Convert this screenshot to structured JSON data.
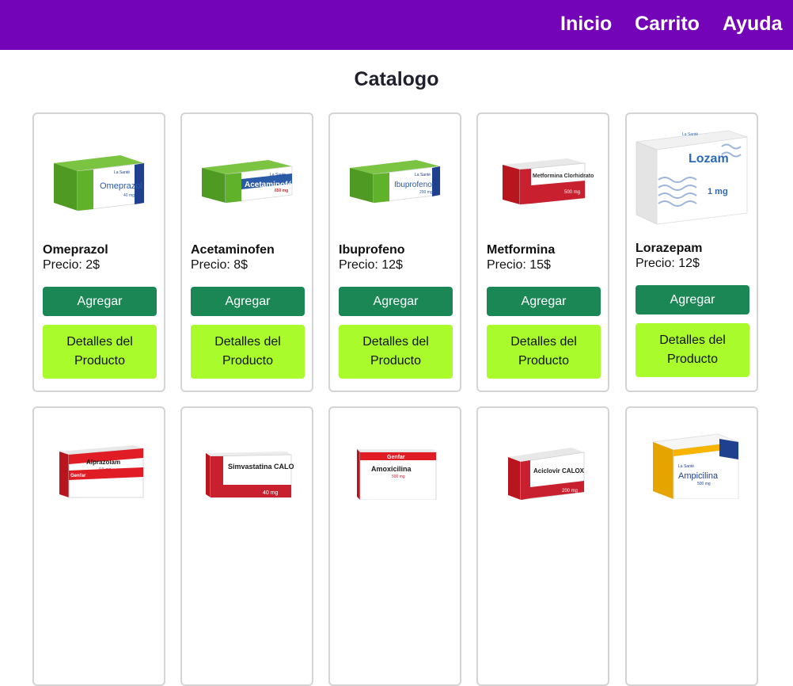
{
  "nav": {
    "links": [
      {
        "label": "Inicio"
      },
      {
        "label": "Carrito"
      },
      {
        "label": "Ayuda"
      }
    ]
  },
  "catalog": {
    "title": "Catalogo",
    "add_label": "Agregar",
    "details_label": "Detalles del Producto",
    "products": [
      {
        "name": "Omeprazol",
        "price": "Precio: 2$",
        "box": {
          "brand": "La Santé",
          "title": "Omeprazol",
          "dose": "40 mg",
          "color": "#5fb22a",
          "face": "#ffffff"
        }
      },
      {
        "name": "Acetaminofen",
        "price": "Precio: 8$",
        "box": {
          "brand": "La Santé",
          "title": "Acetaminofén",
          "dose": "650 mg",
          "color": "#5fb22a",
          "face": "#2b5aa8"
        }
      },
      {
        "name": "Ibuprofeno",
        "price": "Precio: 12$",
        "box": {
          "brand": "La Santé",
          "title": "Ibuprofeno",
          "dose": "200 mg",
          "color": "#5fb22a",
          "face": "#ffffff"
        }
      },
      {
        "name": "Metformina",
        "price": "Precio: 15$",
        "box": {
          "brand": "",
          "title": "Metformina Clorhidrato",
          "dose": "500 mg",
          "color": "#c8202f",
          "face": "#ffffff"
        }
      },
      {
        "name": "Lorazepam",
        "price": "Precio: 12$",
        "box": {
          "brand": "La Santé",
          "title": "Lozam",
          "dose": "1 mg",
          "color": "#f3f3f3",
          "face": "#ffffff"
        }
      },
      {
        "name": "",
        "price": "",
        "box": {
          "brand": "Genfar",
          "title": "Alprazolam",
          "dose": "0,5 mg",
          "color": "#e01c24",
          "face": "#ffffff"
        }
      },
      {
        "name": "",
        "price": "",
        "box": {
          "brand": "",
          "title": "Simvastatina CALOX",
          "dose": "40 mg",
          "color": "#c8202f",
          "face": "#ffffff"
        }
      },
      {
        "name": "",
        "price": "",
        "box": {
          "brand": "Genfar",
          "title": "Amoxicilina",
          "dose": "500 mg",
          "color": "#e01c24",
          "face": "#ffffff"
        }
      },
      {
        "name": "",
        "price": "",
        "box": {
          "brand": "",
          "title": "Aciclovir CALOX",
          "dose": "200 mg",
          "color": "#c8202f",
          "face": "#ffffff"
        }
      },
      {
        "name": "",
        "price": "",
        "box": {
          "brand": "La Santé",
          "title": "Ampicilina",
          "dose": "500 mg",
          "color": "#f7b500",
          "face": "#ffffff"
        }
      }
    ]
  }
}
